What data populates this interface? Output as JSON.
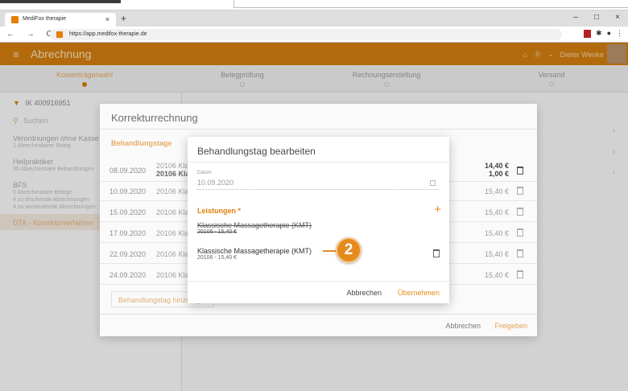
{
  "browser": {
    "tab_title": "MediFox therapie",
    "tab_close": "×",
    "new_tab": "+",
    "nav": "← → C",
    "url": "https://app.medifox-therapie.de",
    "window_controls": [
      "–",
      "□",
      "×"
    ]
  },
  "appbar": {
    "menu_icon": "≡",
    "title": "Abrechnung",
    "user": "Dieter Wenke",
    "icons": [
      "home-icon",
      "help-icon",
      "chevron-down-icon",
      "avatar"
    ]
  },
  "steps": [
    {
      "label": "Kostenträgerwahl",
      "active": true
    },
    {
      "label": "Belegprüfung",
      "active": false
    },
    {
      "label": "Rechnungserstellung",
      "active": false
    },
    {
      "label": "Versand",
      "active": false
    }
  ],
  "sidebar": {
    "filter": "IK 400916951",
    "search_placeholder": "Suchen",
    "items": [
      {
        "title": "Verordnungen ohne Kasse",
        "sub": [
          "1 Abrechenbarer Beleg"
        ]
      },
      {
        "title": "Heilpraktiker",
        "sub": [
          "95 Abrechenbare Behandlungen"
        ]
      },
      {
        "title": "BFS",
        "sub": [
          "0 Abrechenbare Belege",
          "4 zu druckende Abrechnungen",
          "4 zu versendende Abrechnungen"
        ]
      },
      {
        "title": "DTA - Korrekturverfahren",
        "sub": [],
        "highlighted": true
      }
    ]
  },
  "korrektur": {
    "title": "Korrekturrechnung",
    "section": "Behandlungstage",
    "rows": [
      {
        "date": "08.09.2020",
        "code": "20106 Kla",
        "code2": "20106 Kla",
        "price": "14,40 €",
        "price2": "1,00 €"
      },
      {
        "date": "10.09.2020",
        "code": "20106 Kla",
        "price": "15,40 €"
      },
      {
        "date": "15.09.2020",
        "code": "20106 Kla",
        "price": "15,40 €"
      },
      {
        "date": "17.09.2020",
        "code": "20106 Kla",
        "price": "15,40 €"
      },
      {
        "date": "22.09.2020",
        "code": "20106 Kla",
        "price": "15,40 €"
      },
      {
        "date": "24.09.2020",
        "code": "20106 Kla",
        "price": "15,40 €"
      }
    ],
    "add_button": "Behandlungstag hinzufügen",
    "cancel": "Abbrechen",
    "release": "Freigeben"
  },
  "edit_dialog": {
    "title": "Behandlungstag bearbeiten",
    "date_label": "Datum",
    "date_value": "10.09.2020",
    "services_label": "Leistungen *",
    "add_icon": "+",
    "services": [
      {
        "name": "Klassische Massagetherapie (KMT)",
        "detail": "20106 - 15,40 €",
        "struck": true
      },
      {
        "name": "Klassische Massagetherapie (KMT)",
        "detail": "20106 - 15,40 €",
        "struck": false
      }
    ],
    "cancel": "Abbrechen",
    "confirm": "Übernehmen"
  },
  "callout": "2",
  "colors": {
    "accent": "#e58b1e",
    "appbar": "#d07c0f"
  }
}
